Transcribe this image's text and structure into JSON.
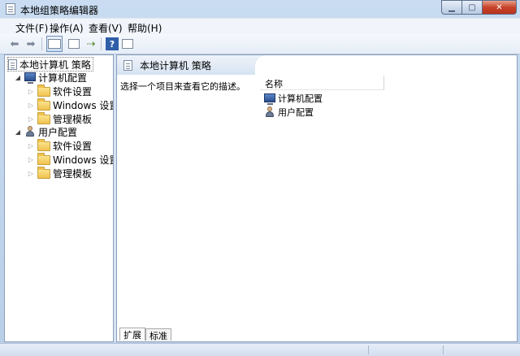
{
  "window": {
    "title": "本地组策略编辑器"
  },
  "menu": [
    "文件(F)",
    "操作(A)",
    "查看(V)",
    "帮助(H)"
  ],
  "toolbar": {
    "back_icon": "back-arrow-icon",
    "forward_icon": "forward-arrow-icon",
    "help_glyph": "?"
  },
  "tree": {
    "root": "本地计算机 策略",
    "computer": {
      "label": "计算机配置",
      "children": [
        "软件设置",
        "Windows 设置",
        "管理模板"
      ]
    },
    "user": {
      "label": "用户配置",
      "children": [
        "软件设置",
        "Windows 设置",
        "管理模板"
      ]
    }
  },
  "details": {
    "title": "本地计算机 策略",
    "description": "选择一个项目来查看它的描述。",
    "column_name": "名称",
    "items": [
      "计算机配置",
      "用户配置"
    ]
  },
  "tabs": [
    "扩展",
    "标准"
  ]
}
